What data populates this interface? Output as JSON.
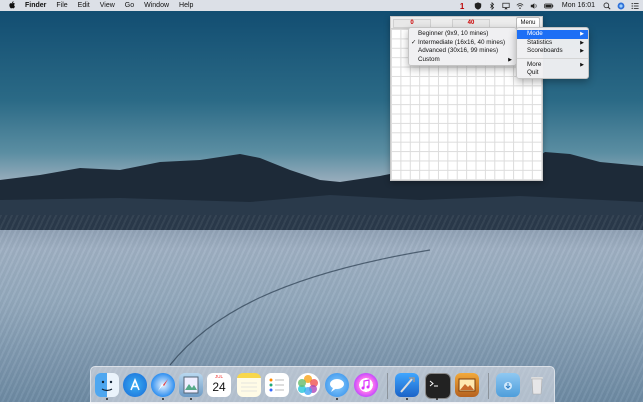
{
  "menubar": {
    "apple": "",
    "app": "Finder",
    "items": [
      "File",
      "Edit",
      "View",
      "Go",
      "Window",
      "Help"
    ],
    "clock": "Mon 16:01"
  },
  "minesweeper": {
    "left_counter": "0",
    "right_counter": "40",
    "menu_button": "Menu"
  },
  "app_menu": {
    "items": [
      {
        "label": "Mode",
        "arrow": "▶",
        "active": true
      },
      {
        "label": "Statistics",
        "arrow": "▶"
      },
      {
        "label": "Scoreboards",
        "arrow": "▶"
      },
      {
        "label": "More",
        "arrow": "▶"
      },
      {
        "label": "Quit",
        "arrow": ""
      }
    ]
  },
  "mode_submenu": {
    "items": [
      {
        "label": "Beginner (9x9, 10 mines)",
        "checked": false
      },
      {
        "label": "Intermediate (16x16, 40 mines)",
        "checked": true
      },
      {
        "label": "Advanced (30x16, 99 mines)",
        "checked": false
      },
      {
        "label": "Custom",
        "arrow": "▶"
      }
    ],
    "checkmark": "✓"
  },
  "dock": {
    "date_month": "JUL",
    "date_day": "24",
    "apps": [
      "finder-icon",
      "app-store-icon",
      "safari-icon",
      "preview-icon",
      "calendar-icon",
      "notes-icon",
      "reminders-icon",
      "photos-icon",
      "messages-icon",
      "itunes-icon",
      "xcode-icon",
      "terminal-icon",
      "instruments-icon",
      "downloads-folder-icon",
      "trash-icon"
    ]
  }
}
